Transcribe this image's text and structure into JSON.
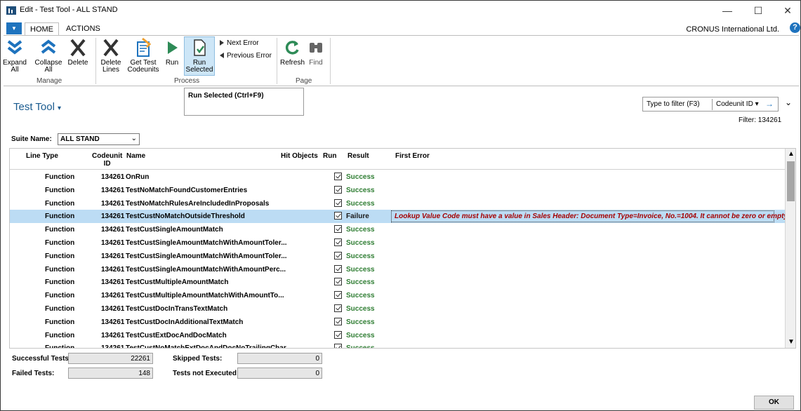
{
  "window": {
    "title": "Edit - Test Tool - ALL STAND",
    "min_glyph": "—",
    "max_glyph": "☐",
    "close_glyph": "✕"
  },
  "tabs": {
    "home": "HOME",
    "actions": "ACTIONS",
    "company": "CRONUS International Ltd.",
    "help": "?"
  },
  "ribbon": {
    "expand_all": "Expand\nAll",
    "collapse_all": "Collapse\nAll",
    "delete": "Delete",
    "manage_group": "Manage",
    "delete_lines": "Delete\nLines",
    "get_test_codeunits": "Get Test\nCodeunits",
    "run": "Run",
    "run_selected": "Run\nSelected",
    "next_error": "Next Error",
    "previous_error": "Previous Error",
    "process_group": "Process",
    "refresh": "Refresh",
    "find": "Find",
    "page_group": "Page"
  },
  "tooltip": "Run Selected (Ctrl+F9)",
  "page": {
    "title": "Test Tool",
    "title_caret": "▾",
    "filter_placeholder": "Type to filter (F3)",
    "filter_field": "Codeunit ID",
    "filter_status": "Filter: 134261",
    "suite_label": "Suite Name:",
    "suite_value": "ALL STAND"
  },
  "grid": {
    "headers": {
      "line_type": "Line Type",
      "codeunit_id": "Codeunit\nID",
      "name": "Name",
      "hit_objects": "Hit Objects",
      "run": "Run",
      "result": "Result",
      "first_error": "First Error"
    },
    "rows": [
      {
        "type": "Function",
        "id": "134261",
        "name": "OnRun",
        "run": true,
        "result": "Success",
        "error": ""
      },
      {
        "type": "Function",
        "id": "134261",
        "name": "TestNoMatchFoundCustomerEntries",
        "run": true,
        "result": "Success",
        "error": ""
      },
      {
        "type": "Function",
        "id": "134261",
        "name": "TestNoMatchRulesAreIncludedInProposals",
        "run": true,
        "result": "Success",
        "error": ""
      },
      {
        "type": "Function",
        "id": "134261",
        "name": "TestCustNoMatchOutsideThreshold",
        "run": true,
        "result": "Failure",
        "error": "Lookup Value Code must have a value in Sales Header: Document Type=Invoice, No.=1004. It cannot be zero or empty."
      },
      {
        "type": "Function",
        "id": "134261",
        "name": "TestCustSingleAmountMatch",
        "run": true,
        "result": "Success",
        "error": ""
      },
      {
        "type": "Function",
        "id": "134261",
        "name": "TestCustSingleAmountMatchWithAmountToler...",
        "run": true,
        "result": "Success",
        "error": ""
      },
      {
        "type": "Function",
        "id": "134261",
        "name": "TestCustSingleAmountMatchWithAmountToler...",
        "run": true,
        "result": "Success",
        "error": ""
      },
      {
        "type": "Function",
        "id": "134261",
        "name": "TestCustSingleAmountMatchWithAmountPerc...",
        "run": true,
        "result": "Success",
        "error": ""
      },
      {
        "type": "Function",
        "id": "134261",
        "name": "TestCustMultipleAmountMatch",
        "run": true,
        "result": "Success",
        "error": ""
      },
      {
        "type": "Function",
        "id": "134261",
        "name": "TestCustMultipleAmountMatchWithAmountTo...",
        "run": true,
        "result": "Success",
        "error": ""
      },
      {
        "type": "Function",
        "id": "134261",
        "name": "TestCustDocInTransTextMatch",
        "run": true,
        "result": "Success",
        "error": ""
      },
      {
        "type": "Function",
        "id": "134261",
        "name": "TestCustDocInAdditionalTextMatch",
        "run": true,
        "result": "Success",
        "error": ""
      },
      {
        "type": "Function",
        "id": "134261",
        "name": "TestCustExtDocAndDocMatch",
        "run": true,
        "result": "Success",
        "error": ""
      },
      {
        "type": "Function",
        "id": "134261",
        "name": "TestCustNoMatchExtDocAndDocNoTrailingChar",
        "run": true,
        "result": "Success",
        "error": ""
      }
    ]
  },
  "stats": {
    "successful_label": "Successful Tests:",
    "successful_value": "22261",
    "failed_label": "Failed Tests:",
    "failed_value": "148",
    "skipped_label": "Skipped Tests:",
    "skipped_value": "0",
    "not_executed_label": "Tests not Executed:",
    "not_executed_value": "0"
  },
  "ok_label": "OK",
  "colors": {
    "accent": "#1e73be",
    "success": "#2e7d32",
    "error": "#a50000",
    "selected_row": "#bcdcf4"
  }
}
